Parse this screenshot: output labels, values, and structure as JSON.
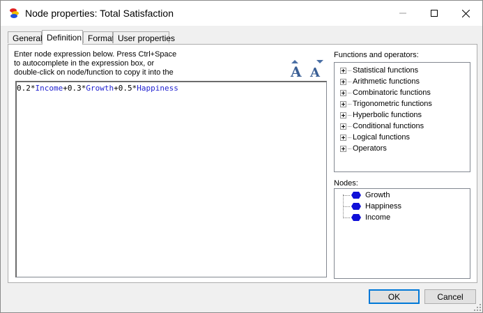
{
  "window": {
    "title": "Node properties: Total Satisfaction",
    "controls": [
      "minimize",
      "maximize",
      "close"
    ]
  },
  "tabs": [
    {
      "label": "General",
      "active": false
    },
    {
      "label": "Definition",
      "active": true
    },
    {
      "label": "Format",
      "active": false
    },
    {
      "label": "User properties",
      "active": false
    }
  ],
  "definition": {
    "instructions": [
      "Enter node expression below. Press Ctrl+Space",
      "to autocomplete in the expression box, or",
      "double-click on node/function to copy it into the"
    ],
    "expression_tokens": [
      {
        "text": "0.2",
        "kind": "num"
      },
      {
        "text": "*",
        "kind": "op"
      },
      {
        "text": "Income",
        "kind": "ident"
      },
      {
        "text": "+",
        "kind": "op"
      },
      {
        "text": "0.3",
        "kind": "num"
      },
      {
        "text": "*",
        "kind": "op"
      },
      {
        "text": "Growth",
        "kind": "ident"
      },
      {
        "text": "+",
        "kind": "op"
      },
      {
        "text": "0.5",
        "kind": "num"
      },
      {
        "text": "*",
        "kind": "op"
      },
      {
        "text": "Happiness",
        "kind": "ident"
      }
    ],
    "font_increase_icon": "font-increase-icon",
    "font_decrease_icon": "font-decrease-icon"
  },
  "functions": {
    "label": "Functions and operators:",
    "items": [
      "Statistical functions",
      "Arithmetic functions",
      "Combinatoric functions",
      "Trigonometric functions",
      "Hyperbolic functions",
      "Conditional functions",
      "Logical functions",
      "Operators"
    ]
  },
  "nodes": {
    "label": "Nodes:",
    "items": [
      "Growth",
      "Happiness",
      "Income"
    ],
    "icon_color": "#1010d8"
  },
  "buttons": {
    "ok": "OK",
    "cancel": "Cancel"
  },
  "colors": {
    "accent": "#0078d7",
    "identifier": "#1f1fd0"
  }
}
